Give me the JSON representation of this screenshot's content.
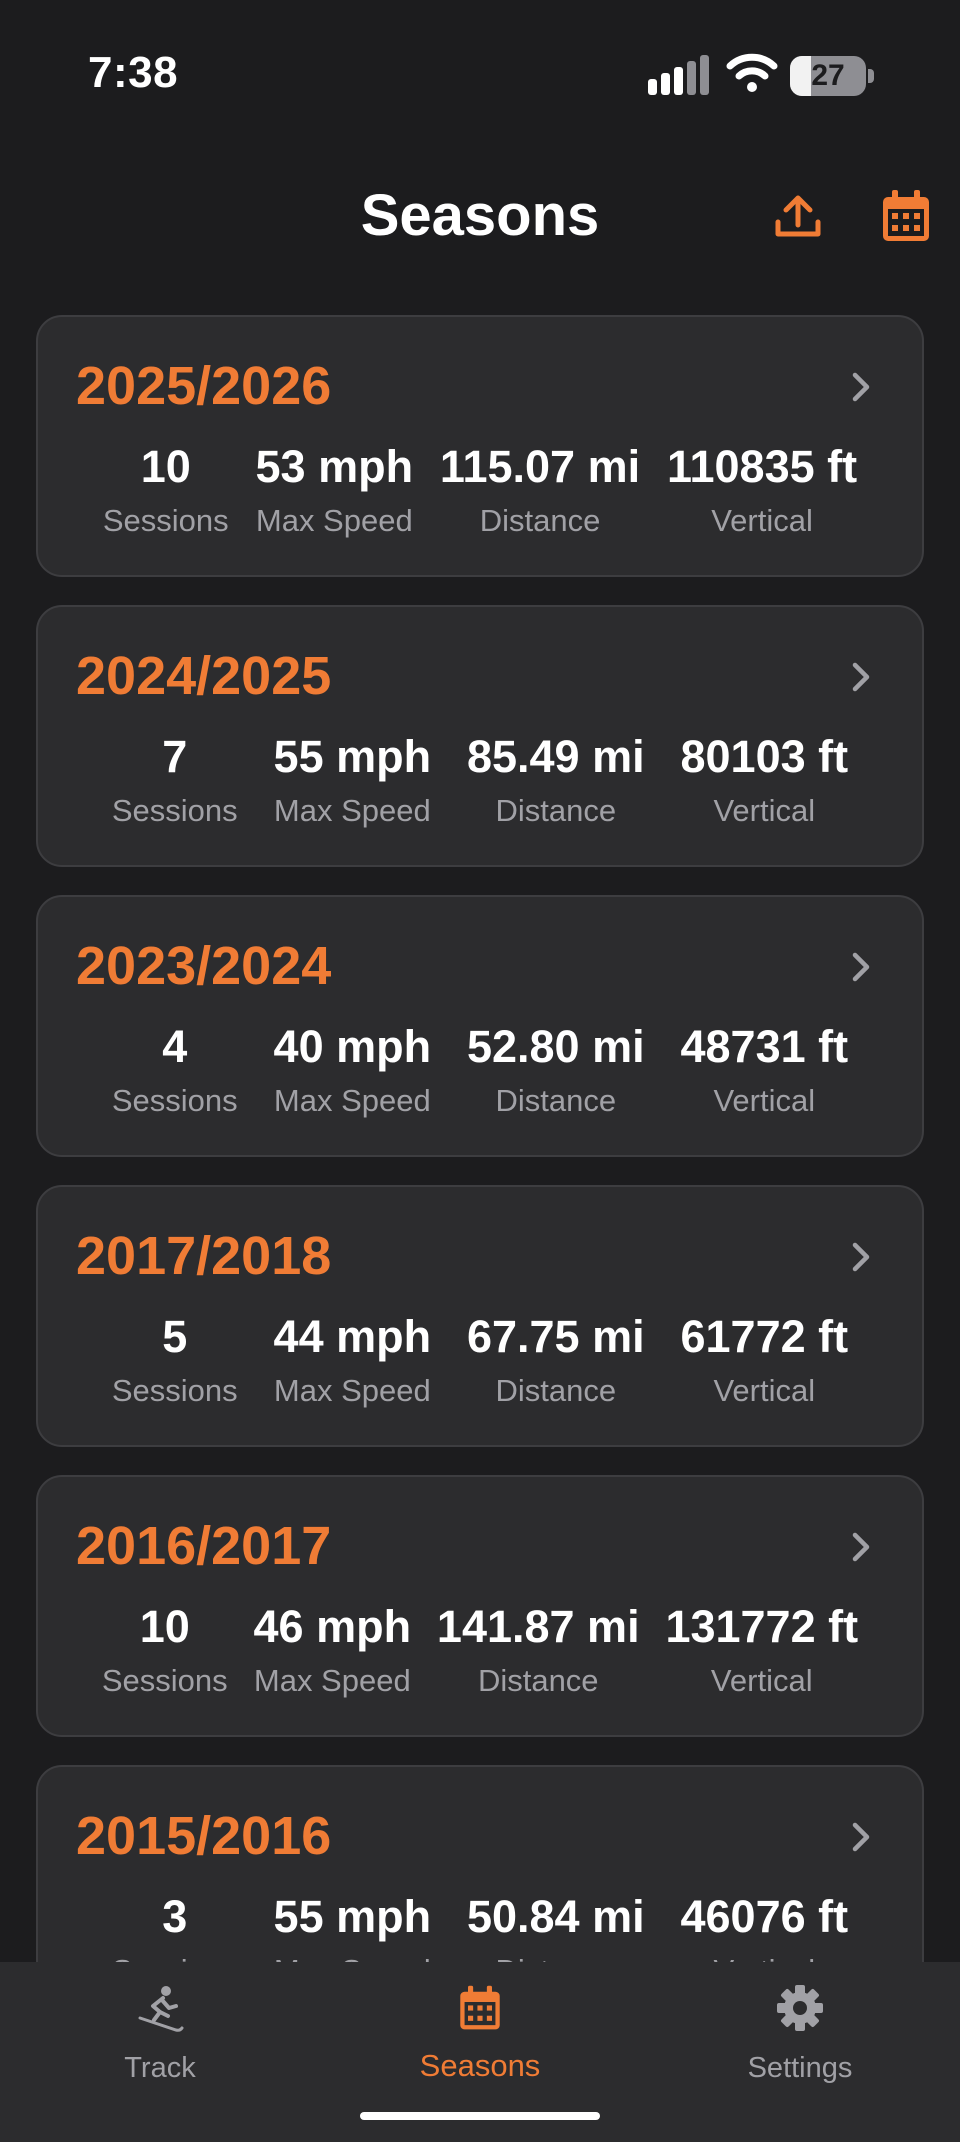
{
  "status_bar": {
    "time": "7:38",
    "battery": "27",
    "battery_level": 0.27
  },
  "header": {
    "title": "Seasons",
    "export_icon": "upload-icon",
    "calendar_icon": "calendar-icon"
  },
  "accent_color": "#f07c35",
  "seasons": [
    {
      "title": "2025/2026",
      "sessions": "10",
      "sessions_label": "Sessions",
      "max_speed": "53 mph",
      "max_speed_label": "Max Speed",
      "distance": "115.07 mi",
      "distance_label": "Distance",
      "vertical": "110835 ft",
      "vertical_label": "Vertical"
    },
    {
      "title": "2024/2025",
      "sessions": "7",
      "sessions_label": "Sessions",
      "max_speed": "55 mph",
      "max_speed_label": "Max Speed",
      "distance": "85.49 mi",
      "distance_label": "Distance",
      "vertical": "80103 ft",
      "vertical_label": "Vertical"
    },
    {
      "title": "2023/2024",
      "sessions": "4",
      "sessions_label": "Sessions",
      "max_speed": "40 mph",
      "max_speed_label": "Max Speed",
      "distance": "52.80 mi",
      "distance_label": "Distance",
      "vertical": "48731 ft",
      "vertical_label": "Vertical"
    },
    {
      "title": "2017/2018",
      "sessions": "5",
      "sessions_label": "Sessions",
      "max_speed": "44 mph",
      "max_speed_label": "Max Speed",
      "distance": "67.75 mi",
      "distance_label": "Distance",
      "vertical": "61772 ft",
      "vertical_label": "Vertical"
    },
    {
      "title": "2016/2017",
      "sessions": "10",
      "sessions_label": "Sessions",
      "max_speed": "46 mph",
      "max_speed_label": "Max Speed",
      "distance": "141.87 mi",
      "distance_label": "Distance",
      "vertical": "131772 ft",
      "vertical_label": "Vertical"
    },
    {
      "title": "2015/2016",
      "sessions": "3",
      "sessions_label": "Sessions",
      "max_speed": "55 mph",
      "max_speed_label": "Max Speed",
      "distance": "50.84 mi",
      "distance_label": "Distance",
      "vertical": "46076 ft",
      "vertical_label": "Vertical"
    }
  ],
  "tabbar": {
    "track": {
      "label": "Track",
      "icon": "skier-icon"
    },
    "seasons": {
      "label": "Seasons",
      "icon": "calendar-icon"
    },
    "settings": {
      "label": "Settings",
      "icon": "gear-icon"
    }
  }
}
